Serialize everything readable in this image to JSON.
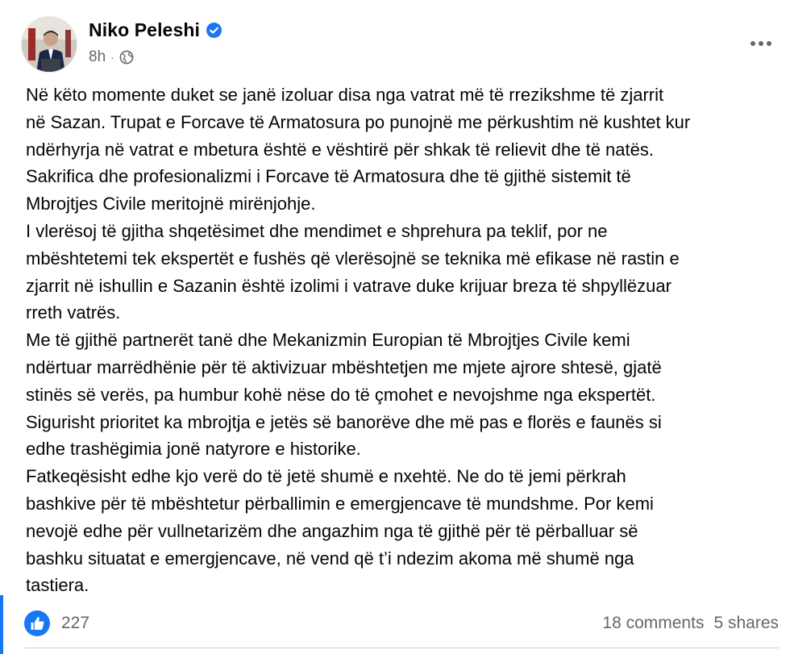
{
  "author": {
    "name": "Niko Peleshi",
    "verified_icon": "verified-badge-icon",
    "time": "8h",
    "separator": "·",
    "audience_icon": "globe-icon"
  },
  "post": {
    "lines": [
      "Në këto momente duket se janë izoluar disa nga vatrat më të rrezikshme të zjarrit",
      "në Sazan. Trupat e Forcave të Armatosura po punojnë me përkushtim në kushtet kur",
      "ndërhyrja në vatrat e mbetura është e vështirë për shkak të relievit dhe të natës.",
      "Sakrifica dhe profesionalizmi i Forcave të Armatosura dhe të gjithë sistemit të",
      "Mbrojtjes Civile meritojnë mirënjohje.",
      "I vlerësoj të gjitha shqetësimet dhe mendimet e shprehura pa teklif, por ne",
      "mbështetemi tek ekspertët e fushës që vlerësojnë se teknika më efikase në rastin e",
      "zjarrit në ishullin e Sazanin është izolimi i vatrave duke krijuar breza të shpyllëzuar",
      "rreth vatrës.",
      "Me të gjithë partnerët tanë dhe Mekanizmin Europian të Mbrojtjes Civile kemi",
      "ndërtuar marrëdhënie për të aktivizuar mbështetjen me mjete ajrore shtesë, gjatë",
      "stinës së verës, pa humbur kohë nëse do të çmohet e nevojshme nga ekspertët.",
      "Sigurisht prioritet ka mbrojtja e jetës së banorëve dhe më pas e florës e faunës si",
      "edhe trashëgimia jonë natyrore e historike.",
      "Fatkeqësisht edhe kjo verë do të jetë shumë e nxehtë. Ne do të jemi përkrah",
      "bashkive për të mbështetur përballimin e emergjencave të mundshme. Por kemi",
      "nevojë edhe për vullnetarizëm dhe angazhim nga të gjithë për të përballuar së",
      "bashku situatat e emergjencave, në vend që t’i ndezim akoma më shumë nga",
      "tastiera."
    ]
  },
  "footer": {
    "reaction_icon": "like-icon",
    "reaction_count": "227",
    "comments": "18 comments",
    "shares": "5 shares"
  },
  "colors": {
    "accent": "#1877f2",
    "text": "#050505",
    "secondary": "#65676b"
  }
}
